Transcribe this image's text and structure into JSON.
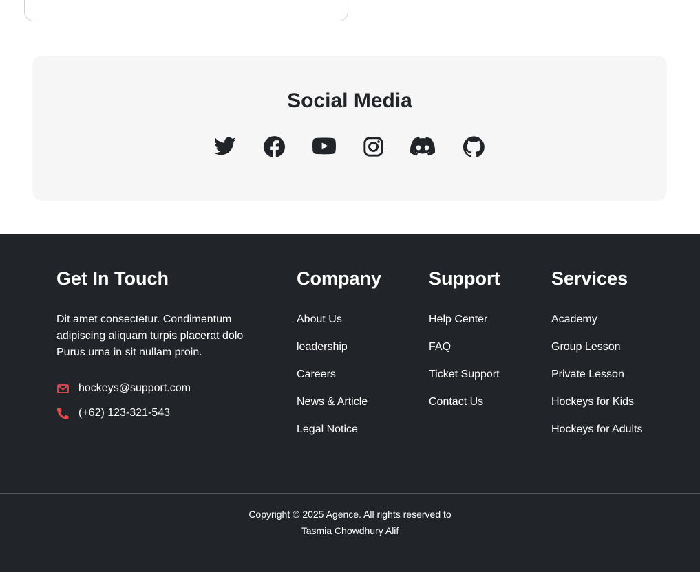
{
  "social": {
    "title": "Social Media",
    "icons": [
      "twitter-icon",
      "facebook-icon",
      "youtube-icon",
      "instagram-icon",
      "discord-icon",
      "github-icon"
    ]
  },
  "footer": {
    "get_in_touch": {
      "title": "Get In Touch",
      "description": "Dit amet consectetur. Condimentum adipiscing aliquam turpis placerat dolo Purus urna in sit nullam proin.",
      "email": "hockeys@support.com",
      "phone": "(+62) 123-321-543"
    },
    "company": {
      "title": "Company",
      "links": [
        "About Us",
        "leadership",
        "Careers",
        "News & Article",
        "Legal Notice"
      ]
    },
    "support": {
      "title": "Support",
      "links": [
        "Help Center",
        "FAQ",
        "Ticket Support",
        "Contact Us"
      ]
    },
    "services": {
      "title": "Services",
      "links": [
        "Academy",
        "Group Lesson",
        "Private Lesson",
        "Hockeys for Kids",
        "Hockeys for Adults"
      ]
    },
    "copyright_line1": "Copyright © 2025 Agence. All rights reserved to",
    "copyright_line2": "Tasmia Chowdhury Alif"
  },
  "colors": {
    "accent": "#e5484d",
    "footer_bg": "#212429",
    "panel_bg": "#f6f6f6",
    "icon": "#212529"
  }
}
